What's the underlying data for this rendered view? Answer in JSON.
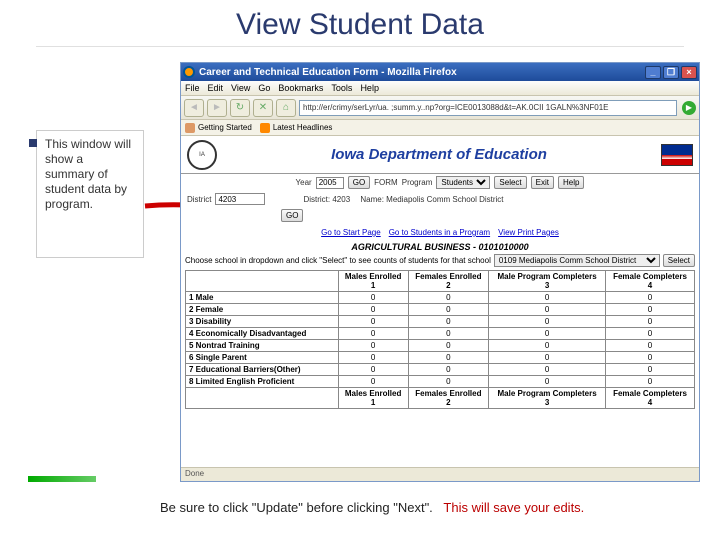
{
  "slide": {
    "title": "View Student Data",
    "side_note": "This window will show a summary of student data by program.",
    "footer_a": "Be sure to click \"Update\" before clicking \"Next\".",
    "footer_b": "This will save your edits."
  },
  "window": {
    "title": "Career and Technical Education Form - Mozilla Firefox",
    "menu": [
      "File",
      "Edit",
      "View",
      "Go",
      "Bookmarks",
      "Tools",
      "Help"
    ],
    "address": "http://er/crimy/serLyr/ua. ;summ.y..np?org=ICE0013088d&t=AK.0CII 1GALN%3NF01E",
    "bookmarks": [
      "Getting Started",
      "Latest Headlines"
    ],
    "status": "Done"
  },
  "page": {
    "dept_title": "Iowa Department of Education",
    "year_label": "Year",
    "year_value": "2005",
    "go": "GO",
    "form_label": "FORM",
    "program_label": "Program",
    "program_value": "Students",
    "select": "Select",
    "exit": "Exit",
    "help": "Help",
    "district_label": "District",
    "district_value": "4203",
    "district2": "District: 4203",
    "name_label": "Name: Mediapolis Comm School District",
    "nav1": "Go to Start Page",
    "nav2": "Go to Students in a Program",
    "nav3": "View Print Pages",
    "prog_title": "AGRICULTURAL BUSINESS - 0101010000",
    "choose_text": "Choose school in dropdown and click \"Select\" to see counts of students for that school",
    "school_value": "0109 Mediapolis Comm School District",
    "cols": [
      {
        "h1": "Males Enrolled",
        "h2": "1"
      },
      {
        "h1": "Females Enrolled",
        "h2": "2"
      },
      {
        "h1": "Male Program Completers",
        "h2": "3"
      },
      {
        "h1": "Female Completers",
        "h2": "4"
      }
    ],
    "rows": [
      {
        "label": "1 Male",
        "v": [
          "0",
          "0",
          "0",
          "0"
        ]
      },
      {
        "label": "2 Female",
        "v": [
          "0",
          "0",
          "0",
          "0"
        ]
      },
      {
        "label": "3 Disability",
        "v": [
          "0",
          "0",
          "0",
          "0"
        ]
      },
      {
        "label": "4 Economically Disadvantaged",
        "v": [
          "0",
          "0",
          "0",
          "0"
        ]
      },
      {
        "label": "5 Nontrad Training",
        "v": [
          "0",
          "0",
          "0",
          "0"
        ]
      },
      {
        "label": "6 Single Parent",
        "v": [
          "0",
          "0",
          "0",
          "0"
        ]
      },
      {
        "label": "7 Educational Barriers(Other)",
        "v": [
          "0",
          "0",
          "0",
          "0"
        ]
      },
      {
        "label": "8 Limited English Proficient",
        "v": [
          "0",
          "0",
          "0",
          "0"
        ]
      }
    ]
  }
}
